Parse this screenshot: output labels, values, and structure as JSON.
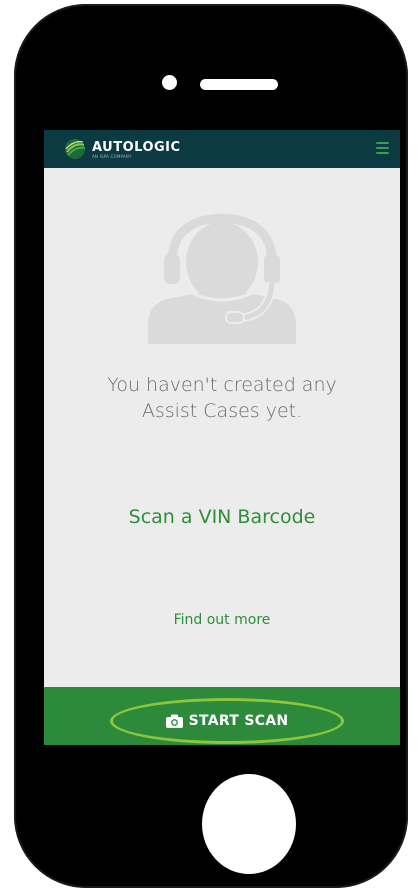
{
  "app": {
    "brand": "AUTOLOGIC",
    "brand_sub": "AN ISPA COMPANY"
  },
  "empty_state": {
    "line1": "You haven't created any",
    "line2": "Assist Cases yet."
  },
  "actions": {
    "scan_vin": "Scan a VIN Barcode",
    "find_out_more": "Find out more",
    "start_scan": "START SCAN"
  },
  "icons": {
    "menu": "hamburger-menu-icon",
    "camera": "camera-icon",
    "agent": "support-agent-icon",
    "logo": "autologic-logo-icon"
  },
  "colors": {
    "header_bg": "#0b3a42",
    "accent_green": "#2f8e3b",
    "bottom_bar": "#2c8a3a",
    "highlight": "#8cc63f",
    "screen_bg": "#ececec"
  }
}
